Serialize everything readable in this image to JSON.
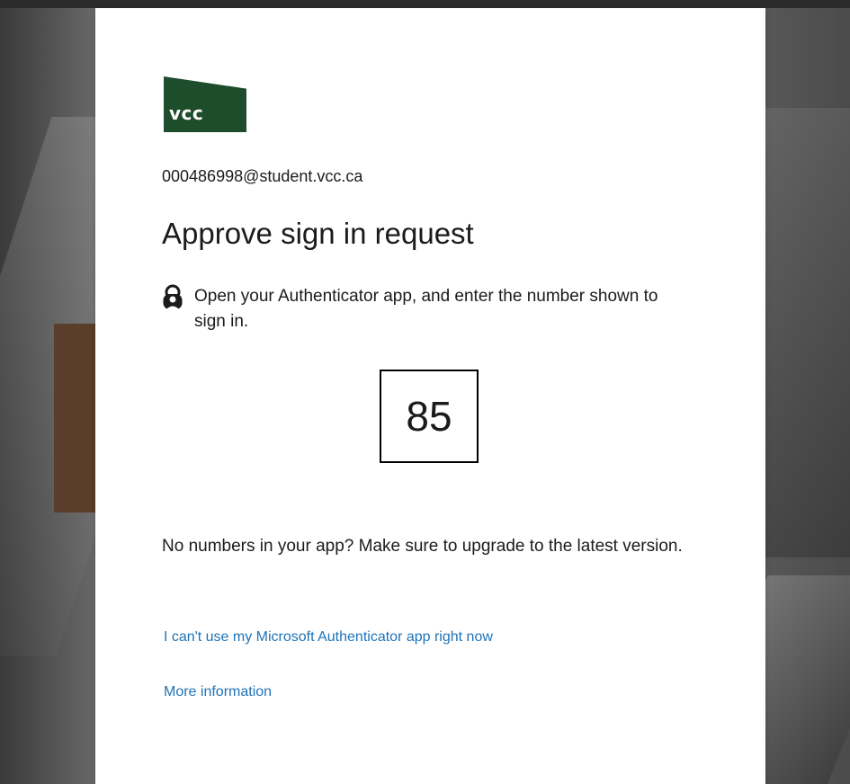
{
  "logo": {
    "text": "vcc",
    "color": "#1e4d2b"
  },
  "account": {
    "email": "000486998@student.vcc.ca"
  },
  "page": {
    "title": "Approve sign in request",
    "instruction": "Open your Authenticator app, and enter the number shown to sign in.",
    "number": "85",
    "upgrade_hint": "No numbers in your app? Make sure to upgrade to the latest version."
  },
  "links": {
    "cant_use": "I can't use my Microsoft Authenticator app right now",
    "more_info": "More information"
  },
  "icons": {
    "instruction_icon": "authenticator-lock-icon"
  },
  "colors": {
    "link": "#1f73b7",
    "text": "#1b1b1b",
    "card_bg": "#ffffff"
  }
}
